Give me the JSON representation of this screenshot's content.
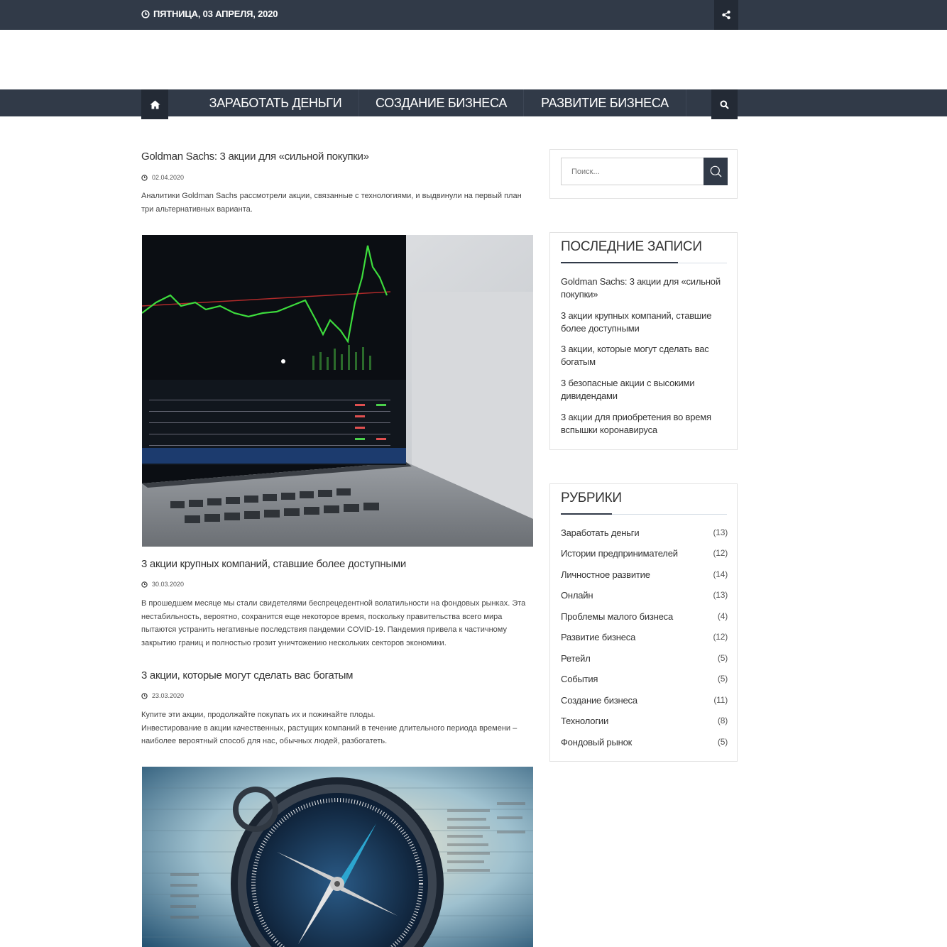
{
  "topbar": {
    "date": "ПЯТНИЦА, 03 АПРЕЛЯ, 2020",
    "clock_icon": "clock-icon",
    "share_icon": "share-icon"
  },
  "nav": {
    "home_icon": "home-icon",
    "items": [
      {
        "label": "ЗАРАБОТАТЬ ДЕНЬГИ"
      },
      {
        "label": "СОЗДАНИЕ БИЗНЕСА"
      },
      {
        "label": "РАЗВИТИЕ БИЗНЕСА"
      }
    ],
    "search_icon": "search-icon"
  },
  "posts": [
    {
      "title": "Goldman Sachs: 3 акции для «сильной покупки»",
      "date": "02.04.2020",
      "excerpt": "Аналитики Goldman Sachs рассмотрели акции, связанные с технологиями, и выдвинули на первый план три альтернативных варианта."
    },
    {
      "title": "3 акции крупных компаний, ставшие более доступными",
      "date": "30.03.2020",
      "excerpt": "В прошедшем месяце мы стали свидетелями беспрецедентной волатильности на фондовых рынках. Эта нестабильность, вероятно, сохранится еще некоторое время, поскольку правительства всего мира пытаются устранить негативные последствия пандемии COVID-19. Пандемия привела к частичному закрытию границ и полностью грозит уничтожению нескольких секторов экономики."
    },
    {
      "title": "3 акции, которые могут сделать вас богатым",
      "date": "23.03.2020",
      "excerpt_line1": "Купите эти акции, продолжайте покупать их и пожинайте плоды.",
      "excerpt_line2": "Инвестирование в акции качественных, растущих компаний в течение длительного периода времени – наиболее вероятный способ для нас, обычных людей, разбогатеть."
    }
  ],
  "sidebar": {
    "search_placeholder": "Поиск...",
    "recent_title": "ПОСЛЕДНИЕ ЗАПИСИ",
    "recent": [
      "Goldman Sachs: 3 акции для «сильной покупки»",
      "3 акции крупных компаний, ставшие более доступными",
      "3 акции, которые могут сделать вас богатым",
      "3 безопасные акции с высокими дивидендами",
      "3 акции для приобретения во время вспышки коронавируса"
    ],
    "categories_title": "РУБРИКИ",
    "categories": [
      {
        "name": "Заработать деньги",
        "count": "(13)"
      },
      {
        "name": "Истории предпринимателей",
        "count": "(12)"
      },
      {
        "name": "Личностное развитие",
        "count": "(14)"
      },
      {
        "name": "Онлайн",
        "count": "(13)"
      },
      {
        "name": "Проблемы малого бизнеса",
        "count": "(4)"
      },
      {
        "name": "Развитие бизнеса",
        "count": "(12)"
      },
      {
        "name": "Ретейл",
        "count": "(5)"
      },
      {
        "name": "События",
        "count": "(5)"
      },
      {
        "name": "Создание бизнеса",
        "count": "(11)"
      },
      {
        "name": "Технологии",
        "count": "(8)"
      },
      {
        "name": "Фондовый рынок",
        "count": "(5)"
      }
    ]
  },
  "colors": {
    "bar": "#313a48",
    "bar_dark": "#232a35"
  }
}
